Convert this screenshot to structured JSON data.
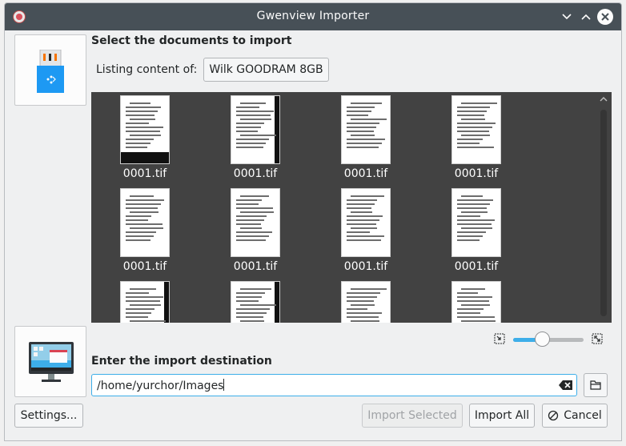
{
  "window": {
    "title": "Gwenview Importer"
  },
  "source": {
    "heading": "Select the documents to import",
    "listing_label": "Listing content of:",
    "device_button": "Wilk GOODRAM 8GB",
    "device_icon": "usb-drive-icon"
  },
  "gallery": {
    "rows": [
      [
        "0001.tif",
        "0001.tif",
        "0001.tif",
        "0001.tif"
      ],
      [
        "0001.tif",
        "0001.tif",
        "0001.tif",
        "0001.tif"
      ],
      [
        "",
        "",
        "",
        ""
      ]
    ]
  },
  "zoom": {
    "level": 0.42
  },
  "destination": {
    "heading": "Enter the import destination",
    "path": "/home/yurchor/Images",
    "computer_icon": "computer-monitor-icon"
  },
  "buttons": {
    "settings": "Settings...",
    "import_selected": "Import Selected",
    "import_all": "Import All",
    "cancel": "Cancel"
  },
  "colors": {
    "accent": "#3daee9",
    "titlebar": "#475057",
    "gallery_bg": "#424242"
  }
}
